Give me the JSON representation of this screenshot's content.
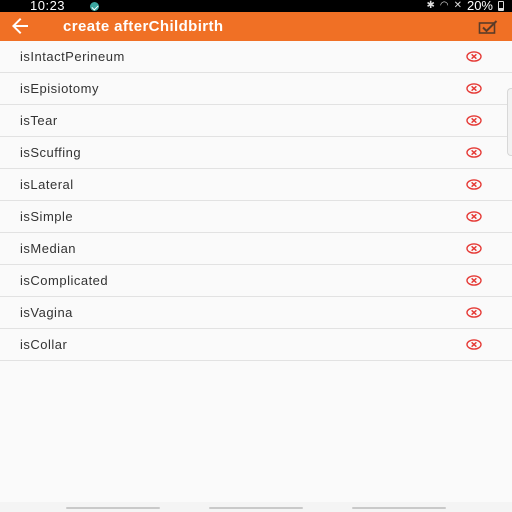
{
  "status_bar": {
    "time": "10:23",
    "battery_percent": "20%",
    "icons": [
      "app-notification-icon",
      "bluetooth-icon",
      "wifi-icon",
      "mute-icon",
      "battery-icon"
    ]
  },
  "app_bar": {
    "title": "create afterChildbirth",
    "back_icon": "arrow-left-icon",
    "save_icon": "check-box-icon",
    "background_color": "#f07025"
  },
  "fields": [
    {
      "label": "isIntactPerineum"
    },
    {
      "label": "isEpisiotomy"
    },
    {
      "label": "isTear"
    },
    {
      "label": "isScuffing"
    },
    {
      "label": "isLateral"
    },
    {
      "label": "isSimple"
    },
    {
      "label": "isMedian"
    },
    {
      "label": "isComplicated"
    },
    {
      "label": "isVagina"
    },
    {
      "label": "isCollar"
    }
  ],
  "field_icon": "remove-circle-icon",
  "field_icon_color": "#e53935"
}
